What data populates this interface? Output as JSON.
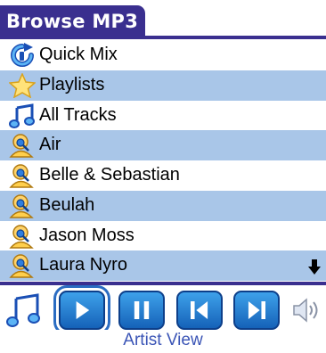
{
  "window": {
    "title": "Browse MP3"
  },
  "list": {
    "items": [
      {
        "label": "Quick Mix",
        "icon": "quick-mix-icon",
        "highlight": false
      },
      {
        "label": "Playlists",
        "icon": "star-icon",
        "highlight": true
      },
      {
        "label": "All Tracks",
        "icon": "music-note-icon",
        "highlight": false
      },
      {
        "label": "Air",
        "icon": "artist-icon",
        "highlight": true
      },
      {
        "label": "Belle & Sebastian",
        "icon": "artist-icon",
        "highlight": false
      },
      {
        "label": "Beulah",
        "icon": "artist-icon",
        "highlight": true
      },
      {
        "label": "Jason Moss",
        "icon": "artist-icon",
        "highlight": false
      },
      {
        "label": "Laura Nyro",
        "icon": "artist-icon",
        "highlight": true
      }
    ]
  },
  "toolbar": {
    "buttons": [
      "music-note-icon",
      "play-icon",
      "pause-icon",
      "previous-icon",
      "next-icon",
      "speaker-icon"
    ]
  },
  "caption": "Artist View",
  "colors": {
    "accent": "#3a2f8f",
    "highlight": "#a9c6e8",
    "button": "#1f79d6",
    "caption": "#3b55b6"
  }
}
